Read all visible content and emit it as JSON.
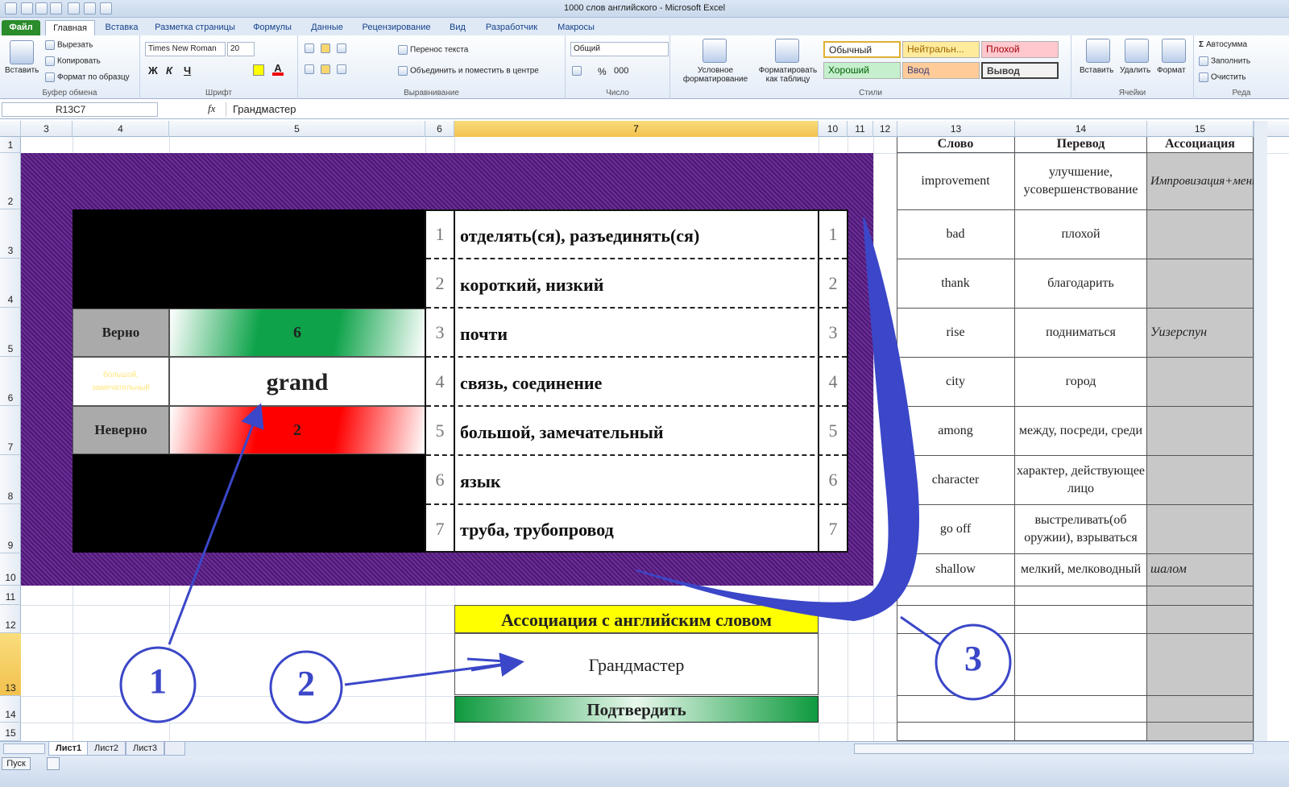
{
  "window": {
    "title": "1000 слов английского - Microsoft Excel"
  },
  "tabs": [
    "Файл",
    "Главная",
    "Вставка",
    "Разметка страницы",
    "Формулы",
    "Данные",
    "Рецензирование",
    "Вид",
    "Разработчик",
    "Макросы"
  ],
  "ribbon": {
    "clipboard": {
      "paste": "Вставить",
      "cut": "Вырезать",
      "copy": "Копировать",
      "format_painter": "Формат по образцу",
      "label": "Буфер обмена"
    },
    "font": {
      "name": "Times New Roman",
      "size": "20",
      "label": "Шрифт",
      "bold": "Ж",
      "italic": "К",
      "underline": "Ч"
    },
    "alignment": {
      "wrap": "Перенос текста",
      "merge": "Объединить и поместить в центре",
      "label": "Выравнивание"
    },
    "number": {
      "format": "Общий",
      "percent": "%",
      "thousands": "000",
      "label": "Число"
    },
    "styles": {
      "conditional": "Условное форматирование",
      "as_table": "Форматировать как таблицу",
      "normal": "Обычный",
      "neutral": "Нейтральн...",
      "bad": "Плохой",
      "good": "Хороший",
      "input": "Ввод",
      "output": "Вывод",
      "label": "Стили"
    },
    "cells": {
      "insert": "Вставить",
      "delete": "Удалить",
      "format": "Формат",
      "label": "Ячейки"
    },
    "editing": {
      "autosum": "Автосумма",
      "fill": "Заполнить",
      "clear": "Очистить",
      "label": "Реда"
    }
  },
  "formula_bar": {
    "name_box": "R13C7",
    "fx": "fx",
    "value": "Грандмастер"
  },
  "columns": [
    "3",
    "4",
    "5",
    "6",
    "7",
    "10",
    "11",
    "12",
    "13",
    "14",
    "15"
  ],
  "rows": [
    "1",
    "2",
    "3",
    "4",
    "5",
    "6",
    "7",
    "8",
    "9",
    "10",
    "11",
    "12",
    "13",
    "14",
    "15"
  ],
  "game": {
    "correct_label": "Верно",
    "correct_count": "6",
    "hint": "большой, замечательный",
    "word": "grand",
    "wrong_label": "Неверно",
    "wrong_count": "2",
    "options": [
      {
        "n": "1",
        "text": "отделять(ся), разъединять(ся)"
      },
      {
        "n": "2",
        "text": "короткий, низкий"
      },
      {
        "n": "3",
        "text": "почти"
      },
      {
        "n": "4",
        "text": "связь, соединение"
      },
      {
        "n": "5",
        "text": "большой, замечательный"
      },
      {
        "n": "6",
        "text": "язык"
      },
      {
        "n": "7",
        "text": "труба, трубопровод"
      }
    ],
    "assoc_title": "Ассоциация с английским словом",
    "assoc_value": "Грандмастер",
    "confirm": "Подтвердить"
  },
  "vocab": {
    "headers": [
      "Слово",
      "Перевод",
      "Ассоциация"
    ],
    "rows": [
      {
        "word": "improvement",
        "translation": "улучшение, усовершенствование",
        "assoc": "Импровизация+мент"
      },
      {
        "word": "bad",
        "translation": "плохой",
        "assoc": ""
      },
      {
        "word": "thank",
        "translation": "благодарить",
        "assoc": ""
      },
      {
        "word": "rise",
        "translation": "подниматься",
        "assoc": "Уизерспун"
      },
      {
        "word": "city",
        "translation": "город",
        "assoc": ""
      },
      {
        "word": "among",
        "translation": "между, посреди, среди",
        "assoc": ""
      },
      {
        "word": "character",
        "translation": "характер, действующее лицо",
        "assoc": ""
      },
      {
        "word": "go off",
        "translation": "выстреливать(об оружии), взрываться",
        "assoc": ""
      },
      {
        "word": "shallow",
        "translation": "мелкий, мелководный",
        "assoc": "шалом"
      }
    ]
  },
  "callouts": [
    "1",
    "2",
    "3"
  ],
  "sheets": [
    "Лист1",
    "Лист2",
    "Лист3"
  ],
  "status": {
    "ready": "Пуск"
  },
  "colors": {
    "frame": "#5a2382",
    "annotation": "#3b47c8",
    "correct": "#0ea34a",
    "wrong": "#ff0000",
    "assoc_bg": "#ffff00"
  }
}
